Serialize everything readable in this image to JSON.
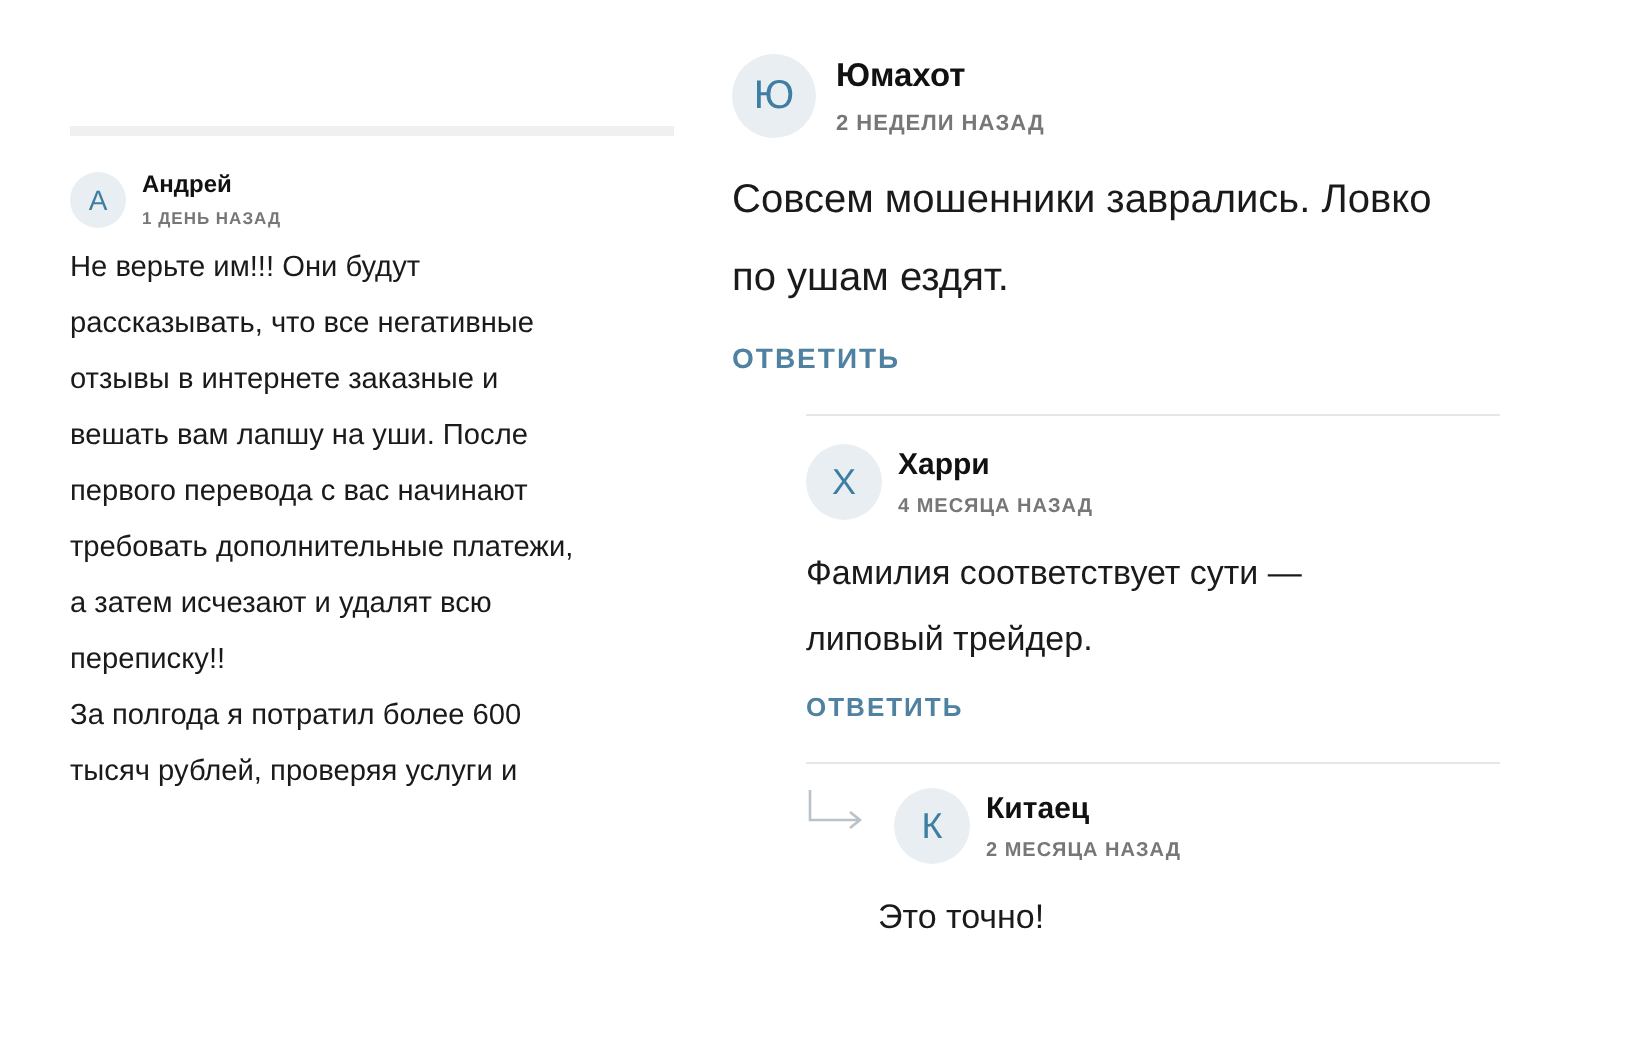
{
  "left_screen": {
    "comments": [
      {
        "avatar_letter": "А",
        "author": "Андрей",
        "time": "1 ДЕНЬ НАЗАД",
        "text": "Не верьте им!!! Они будут\nрассказывать, что все негативные\nотзывы в интернете заказные и\nвешать вам лапшу на уши. После\nпервого перевода с вас начинают\nтребовать дополнительные платежи,\nа затем исчезают и удалят всю\nпереписку!!\nЗа полгода я потратил более 600\nтысяч рублей, проверяя услуги и"
      }
    ]
  },
  "right_screen": {
    "comments": [
      {
        "avatar_letter": "Ю",
        "author": "Юмахот",
        "time": "2 НЕДЕЛИ НАЗАД",
        "text": "Совсем мошенники заврались. Ловко\nпо ушам ездят.",
        "reply_button": "ОТВЕТИТЬ",
        "children": [
          {
            "avatar_letter": "Х",
            "author": "Харри",
            "time": "4 МЕСЯЦА НАЗАД",
            "text": "Фамилия соответствует сути —\nлиповый трейдер.",
            "reply_button": "ОТВЕТИТЬ",
            "children": [
              {
                "avatar_letter": "К",
                "author": "Китаец",
                "time": "2 МЕСЯЦА НАЗАД",
                "text": "Это точно!"
              }
            ]
          }
        ]
      }
    ]
  }
}
